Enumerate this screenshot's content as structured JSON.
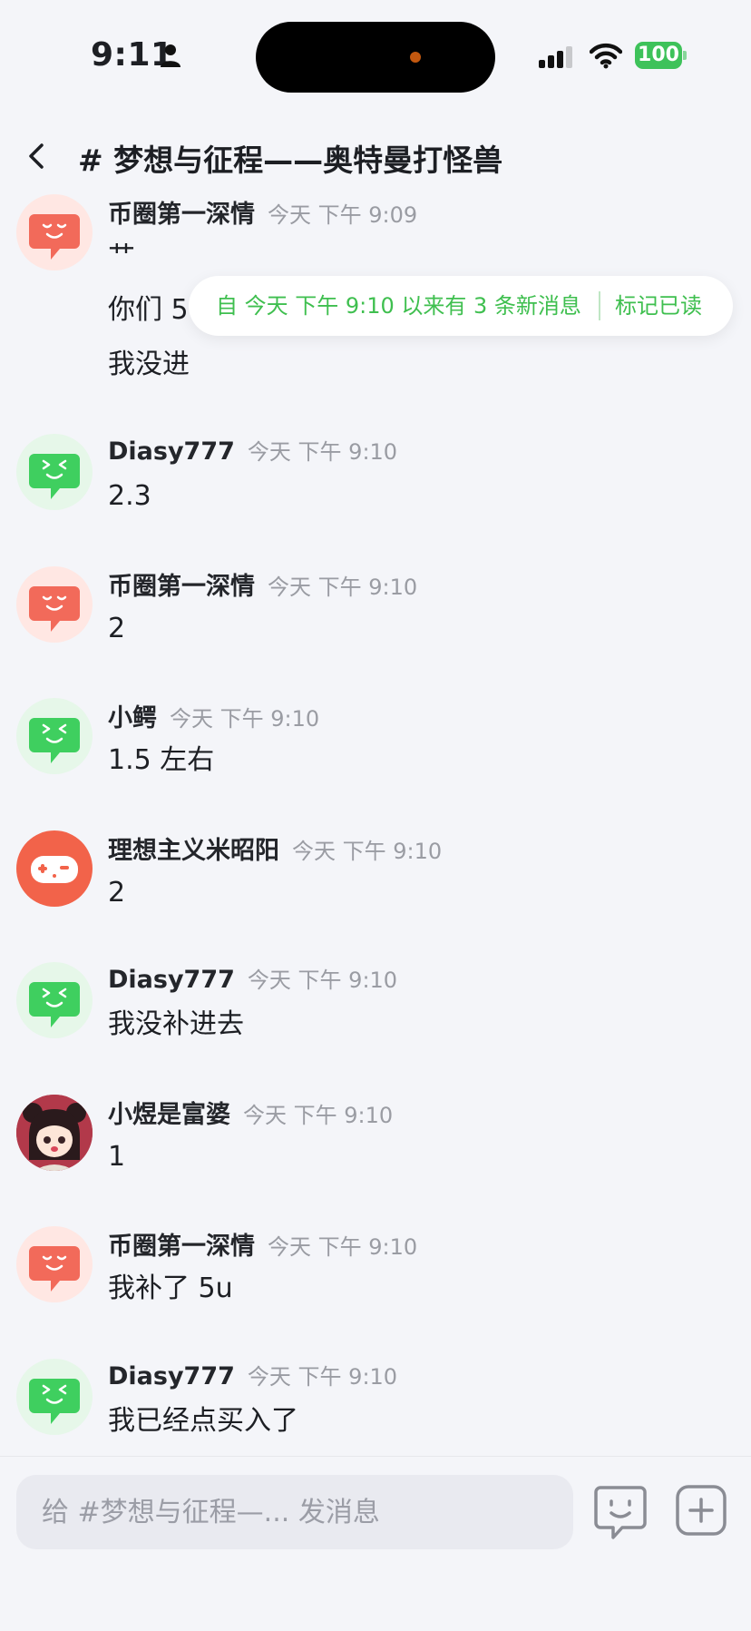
{
  "status_bar": {
    "time": "9:11",
    "battery": "100"
  },
  "header": {
    "title": "# 梦想与征程——奥特曼打怪兽"
  },
  "banner": {
    "text": "自 今天 下午 9:10 以来有 3 条新消息",
    "mark_read": "标记已读"
  },
  "messages": [
    {
      "user": "币圈第一深情",
      "time": "今天 下午 9:09",
      "lines": [
        "艹",
        "你们 5",
        "我没进"
      ],
      "avatar": "red-bubble-avatar"
    },
    {
      "user": "Diasy777",
      "time": "今天 下午 9:10",
      "lines": [
        "2.3"
      ],
      "avatar": "green-bubble-avatar"
    },
    {
      "user": "币圈第一深情",
      "time": "今天 下午 9:10",
      "lines": [
        "2"
      ],
      "avatar": "red-bubble-avatar"
    },
    {
      "user": "小鳄",
      "time": "今天 下午 9:10",
      "lines": [
        "1.5 左右"
      ],
      "avatar": "green-bubble-avatar"
    },
    {
      "user": "理想主义米昭阳",
      "time": "今天 下午 9:10",
      "lines": [
        "2"
      ],
      "avatar": "orange-gamepad-avatar"
    },
    {
      "user": "Diasy777",
      "time": "今天 下午 9:10",
      "lines": [
        "我没补进去"
      ],
      "avatar": "green-bubble-avatar"
    },
    {
      "user": "小煜是富婆",
      "time": "今天 下午 9:10",
      "lines": [
        "1"
      ],
      "avatar": "anime-girl-avatar"
    },
    {
      "user": "币圈第一深情",
      "time": "今天 下午 9:10",
      "lines": [
        "我补了 5u"
      ],
      "avatar": "red-bubble-avatar"
    },
    {
      "user": "Diasy777",
      "time": "今天 下午 9:10",
      "lines": [
        "我已经点买入了"
      ],
      "avatar": "green-bubble-avatar"
    }
  ],
  "input": {
    "placeholder": "给 #梦想与征程—... 发消息"
  },
  "colors": {
    "accent_green": "#3fbf4f",
    "avatar_red": "#f26a5a",
    "avatar_green": "#3fcf5f",
    "avatar_orange": "#f2634a"
  }
}
